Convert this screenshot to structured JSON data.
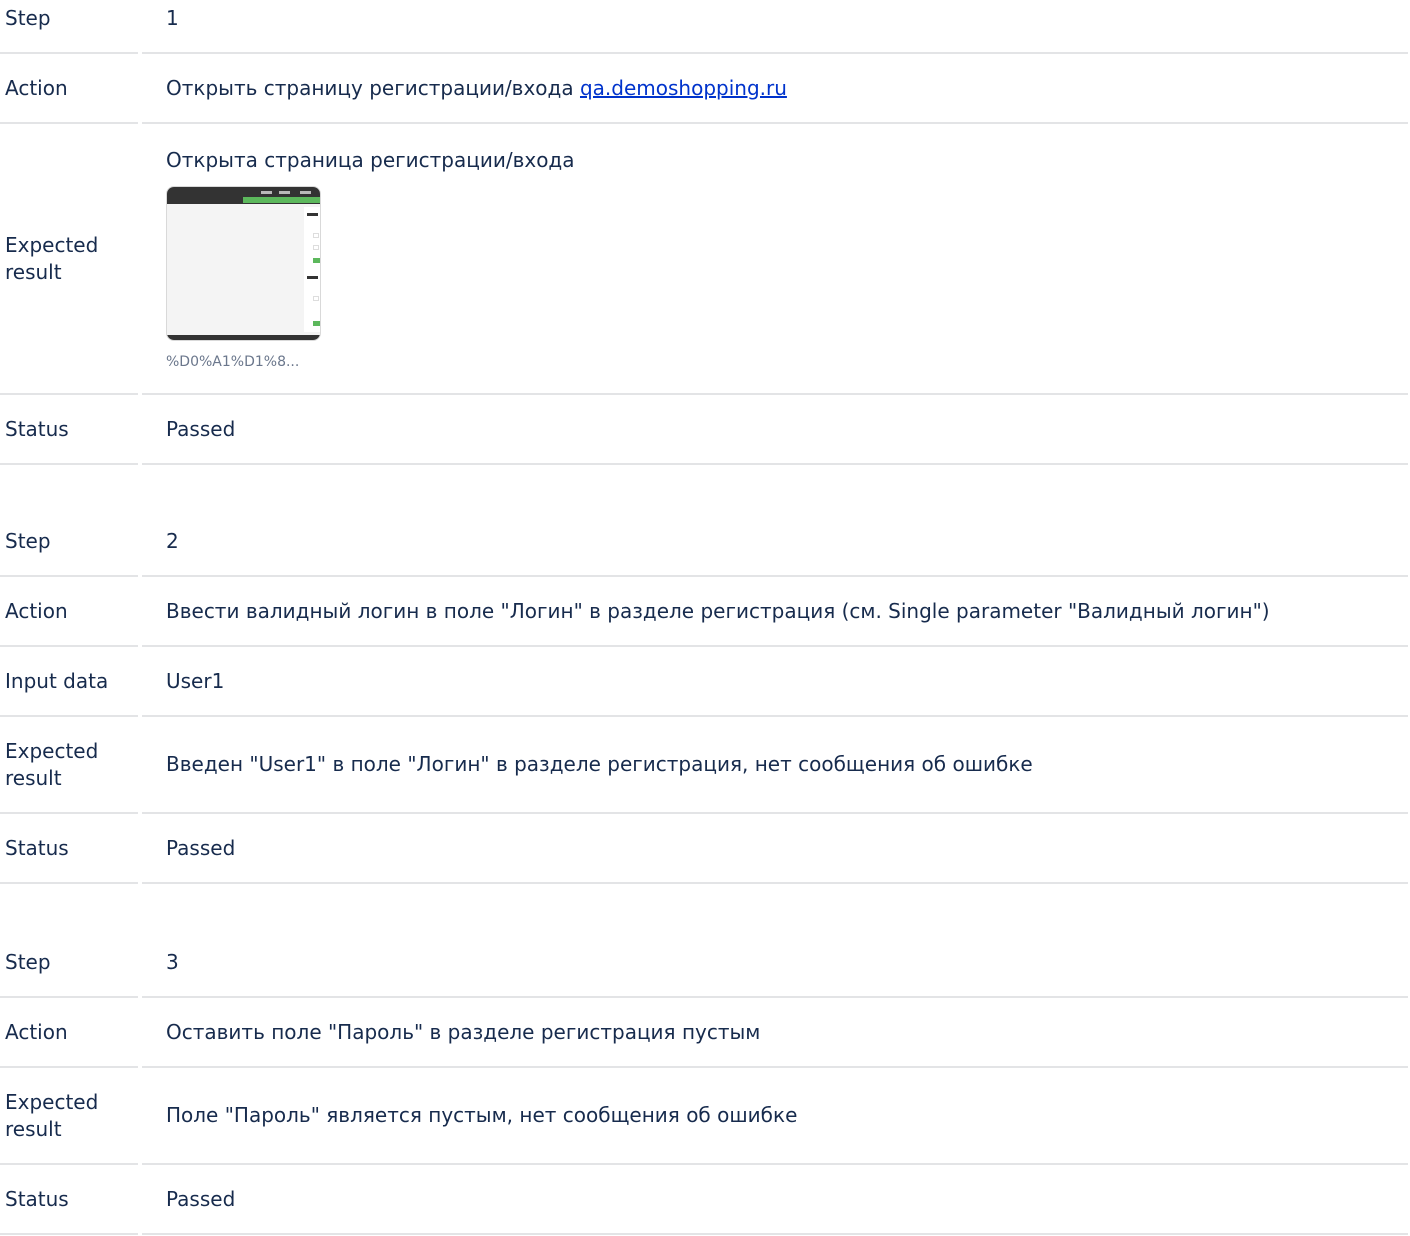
{
  "steps": [
    {
      "step_label": "Step",
      "step_value": "1",
      "action_label": "Action",
      "action_text": "Открыть страницу регистрации/входа ",
      "action_link": "qa.demoshopping.ru",
      "expected_label": "Expected result",
      "expected_text": "Открыта страница регистрации/входа",
      "attachment_name": "%D0%A1%D1%8...",
      "status_label": "Status",
      "status_value": "Passed"
    },
    {
      "step_label": "Step",
      "step_value": "2",
      "action_label": "Action",
      "action_text": "Ввести валидный логин в поле \"Логин\" в разделе регистрация (см. Single parameter \"Валидный логин\")",
      "input_label": "Input data",
      "input_value": "User1",
      "expected_label": "Expected result",
      "expected_text": "Введен \"User1\" в поле \"Логин\" в разделе регистрация, нет сообщения об ошибке",
      "status_label": "Status",
      "status_value": "Passed"
    },
    {
      "step_label": "Step",
      "step_value": "3",
      "action_label": "Action",
      "action_text": "Оставить поле \"Пароль\" в разделе регистрация пустым",
      "expected_label": "Expected result",
      "expected_text": "Поле \"Пароль\" является пустым, нет сообщения об ошибке",
      "status_label": "Status",
      "status_value": "Passed"
    }
  ],
  "colors": {
    "text": "#172b4d",
    "link": "#0033cc",
    "divider": "#e3e4e6",
    "muted": "#6b778c"
  }
}
